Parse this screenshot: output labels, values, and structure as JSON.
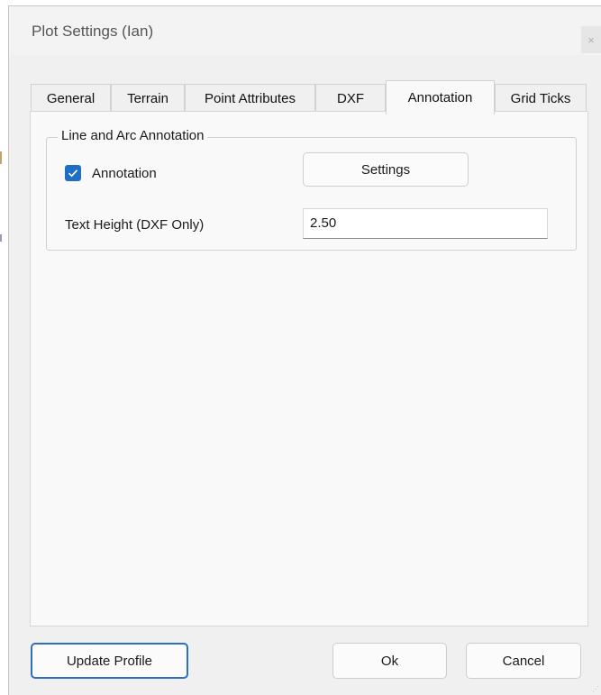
{
  "window": {
    "title": "Plot Settings  (Ian)",
    "close_glyph": "×"
  },
  "tabs": [
    {
      "label": "General",
      "active": false
    },
    {
      "label": "Terrain",
      "active": false
    },
    {
      "label": "Point Attributes",
      "active": false
    },
    {
      "label": "DXF",
      "active": false
    },
    {
      "label": "Annotation",
      "active": true
    },
    {
      "label": "Grid Ticks",
      "active": false
    }
  ],
  "annotation_group": {
    "legend": "Line and Arc Annotation",
    "annotation_checkbox": {
      "label": "Annotation",
      "checked": true
    },
    "settings_button": "Settings",
    "text_height": {
      "label": "Text Height (DXF Only)",
      "value": "2.50"
    }
  },
  "footer": {
    "update_profile": "Update Profile",
    "ok": "Ok",
    "cancel": "Cancel"
  },
  "colors": {
    "accent": "#1f6fc5",
    "default_button_border": "#2f6fc0"
  }
}
